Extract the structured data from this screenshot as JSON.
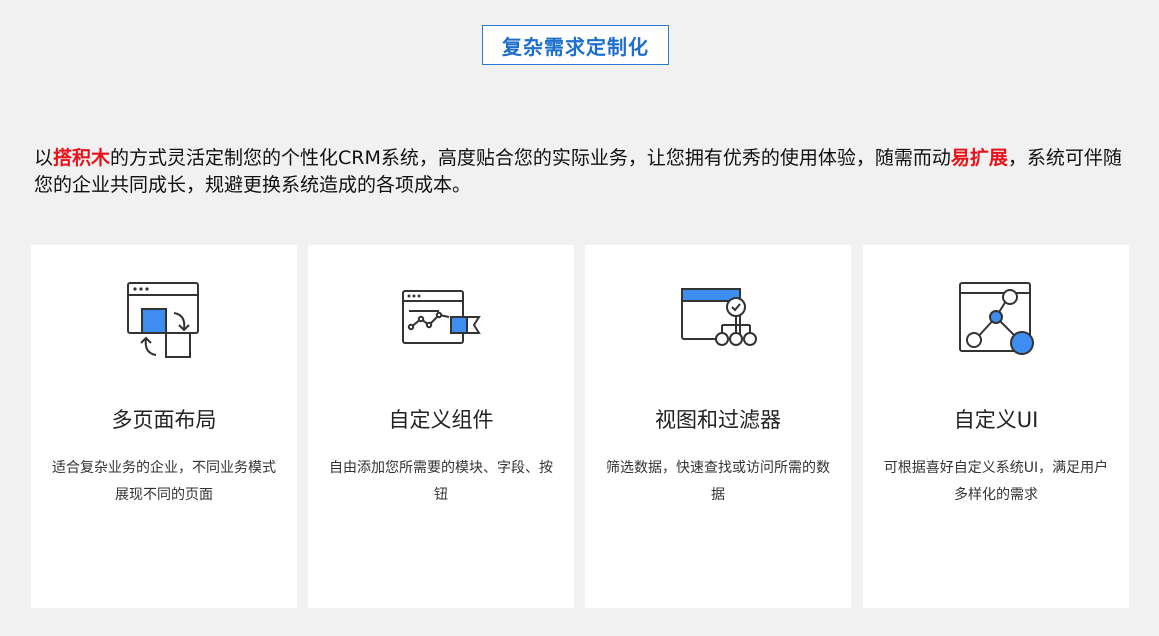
{
  "header": {
    "title": "复杂需求定制化"
  },
  "intro": {
    "p1": "以",
    "hl1": "搭积木",
    "p2": "的方式灵活定制您的个性化CRM系统，高度贴合您的实际业务，让您拥有优秀的使用体验，随需而动",
    "hl2": "易扩展",
    "p3": "，系统可伴随您的企业共同成长，规避更换系统造成的各项成本。"
  },
  "colors": {
    "accent": "#3d8ef0",
    "highlight": "#e8131a",
    "title_blue": "#1e6fcc",
    "icon_stroke": "#333333"
  },
  "cards": [
    {
      "icon": "multi-page-layout-icon",
      "title": "多页面布局",
      "desc": "适合复杂业务的企业，不同业务模式展现不同的页面"
    },
    {
      "icon": "custom-component-icon",
      "title": "自定义组件",
      "desc": "自由添加您所需要的模块、字段、按钮"
    },
    {
      "icon": "view-filter-icon",
      "title": "视图和过滤器",
      "desc": "筛选数据，快速查找或访问所需的数据"
    },
    {
      "icon": "custom-ui-icon",
      "title": "自定义UI",
      "desc": "可根据喜好自定义系统UI，满足用户多样化的需求"
    }
  ]
}
